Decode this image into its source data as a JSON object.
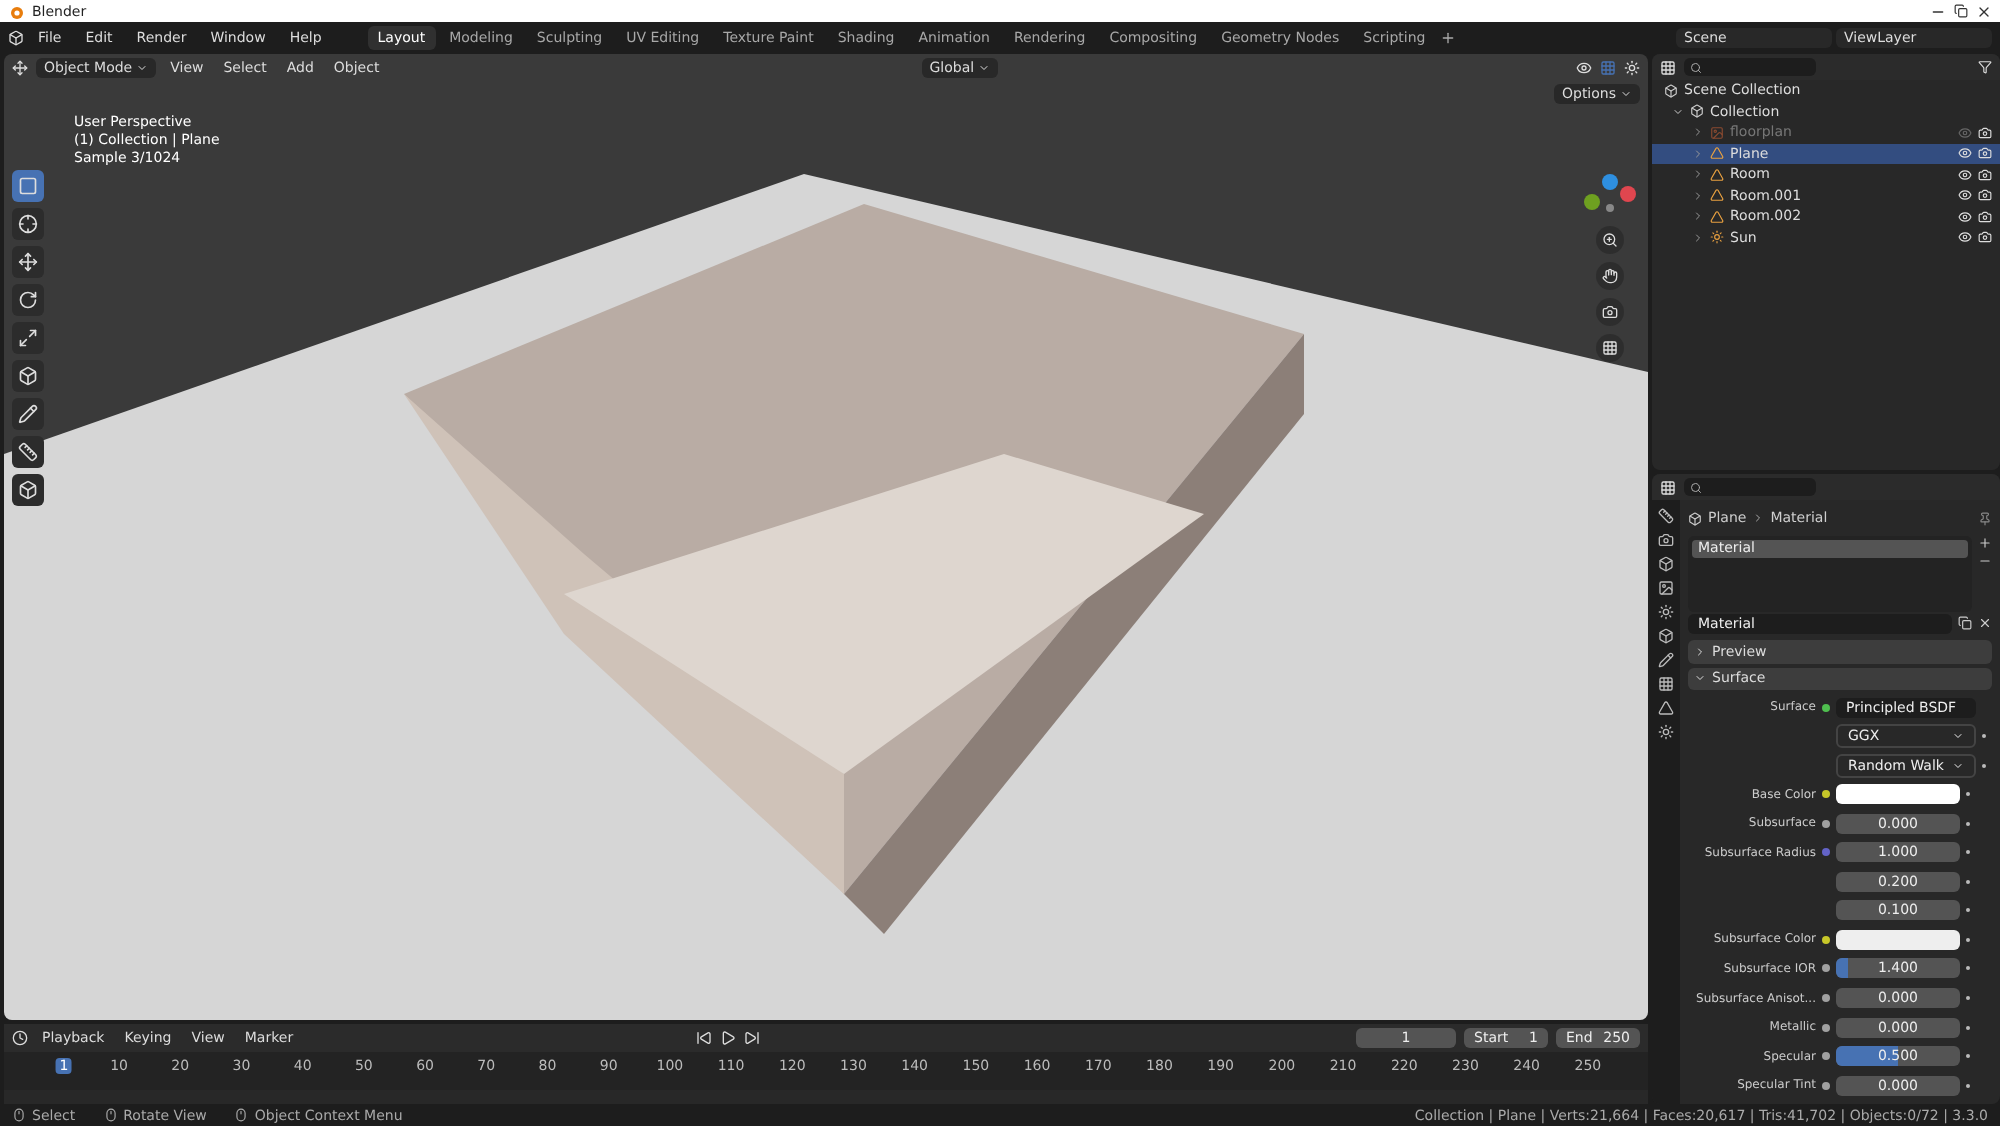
{
  "window": {
    "title": "Blender"
  },
  "menu": [
    "File",
    "Edit",
    "Render",
    "Window",
    "Help"
  ],
  "workspaces": [
    {
      "label": "Layout",
      "selected": true
    },
    {
      "label": "Modeling",
      "selected": false
    },
    {
      "label": "Sculpting",
      "selected": false
    },
    {
      "label": "UV Editing",
      "selected": false
    },
    {
      "label": "Texture Paint",
      "selected": false
    },
    {
      "label": "Shading",
      "selected": false
    },
    {
      "label": "Animation",
      "selected": false
    },
    {
      "label": "Rendering",
      "selected": false
    },
    {
      "label": "Compositing",
      "selected": false
    },
    {
      "label": "Geometry Nodes",
      "selected": false
    },
    {
      "label": "Scripting",
      "selected": false
    }
  ],
  "scene": "Scene",
  "view_layer": "ViewLayer",
  "viewport": {
    "mode": "Object Mode",
    "menus": [
      "View",
      "Select",
      "Add",
      "Object"
    ],
    "orientation": "Global",
    "options": "Options",
    "overlay": [
      "User Perspective",
      "(1) Collection | Plane",
      "Sample 3/1024"
    ],
    "tools": [
      {
        "kind": "select",
        "selected": true
      },
      {
        "kind": "cursor",
        "selected": false
      },
      {
        "kind": "move",
        "selected": false
      },
      {
        "kind": "rotate",
        "selected": false
      },
      {
        "kind": "scale",
        "selected": false
      },
      {
        "kind": "transform",
        "selected": false
      },
      {
        "kind": "annotate",
        "selected": false
      },
      {
        "kind": "measure",
        "selected": false
      },
      {
        "kind": "cube",
        "selected": false
      }
    ]
  },
  "outliner": {
    "root": "Scene Collection",
    "collection": "Collection",
    "items": [
      {
        "name": "floorplan",
        "kind": "image",
        "disabled": true,
        "selected": false
      },
      {
        "name": "Plane",
        "kind": "mesh",
        "disabled": false,
        "selected": true
      },
      {
        "name": "Room",
        "kind": "mesh",
        "disabled": false,
        "selected": false
      },
      {
        "name": "Room.001",
        "kind": "mesh",
        "disabled": false,
        "selected": false
      },
      {
        "name": "Room.002",
        "kind": "mesh",
        "disabled": false,
        "selected": false
      },
      {
        "name": "Sun",
        "kind": "light",
        "disabled": false,
        "selected": false
      }
    ]
  },
  "properties": {
    "breadcrumb": [
      "Plane",
      "Material"
    ],
    "slot": "Material",
    "material": "Material",
    "panels": [
      {
        "label": "Preview",
        "expanded": false
      },
      {
        "label": "Surface",
        "expanded": true
      }
    ],
    "surface_label": "Surface",
    "surface": "Principled BSDF",
    "dropdowns": [
      "GGX",
      "Random Walk"
    ],
    "rows": [
      {
        "label": "Base Color",
        "kind": "color",
        "color": "#ffffff"
      },
      {
        "label": "Subsurface",
        "kind": "float",
        "value": "0.000"
      },
      {
        "label": "Subsurface Radius",
        "kind": "vector",
        "values": [
          "1.000",
          "0.200",
          "0.100"
        ]
      },
      {
        "label": "Subsurface Color",
        "kind": "color",
        "color": "#eeeeee"
      },
      {
        "label": "Subsurface IOR",
        "kind": "float",
        "value": "1.400",
        "level": 0.1
      },
      {
        "label": "Subsurface Anisot...",
        "kind": "float",
        "value": "0.000"
      },
      {
        "label": "Metallic",
        "kind": "float",
        "value": "0.000"
      },
      {
        "label": "Specular",
        "kind": "float",
        "value": "0.500",
        "level": 0.5
      },
      {
        "label": "Specular Tint",
        "kind": "float",
        "value": "0.000"
      }
    ]
  },
  "timeline": {
    "menus": [
      "Playback",
      "Keying",
      "View",
      "Marker"
    ],
    "frame": "1",
    "start_label": "Start",
    "start": "1",
    "end_label": "End",
    "end": "250",
    "ticks": [
      "1",
      "10",
      "20",
      "30",
      "40",
      "50",
      "60",
      "70",
      "80",
      "90",
      "100",
      "110",
      "120",
      "130",
      "140",
      "150",
      "160",
      "170",
      "180",
      "190",
      "200",
      "210",
      "220",
      "230",
      "240",
      "250"
    ]
  },
  "status": {
    "hints": [
      "Select",
      "Rotate View",
      "Object Context Menu"
    ],
    "info": "Collection | Plane | Verts:21,664 | Faces:20,617 | Tris:41,702 | Objects:0/72 | 3.3.0"
  }
}
